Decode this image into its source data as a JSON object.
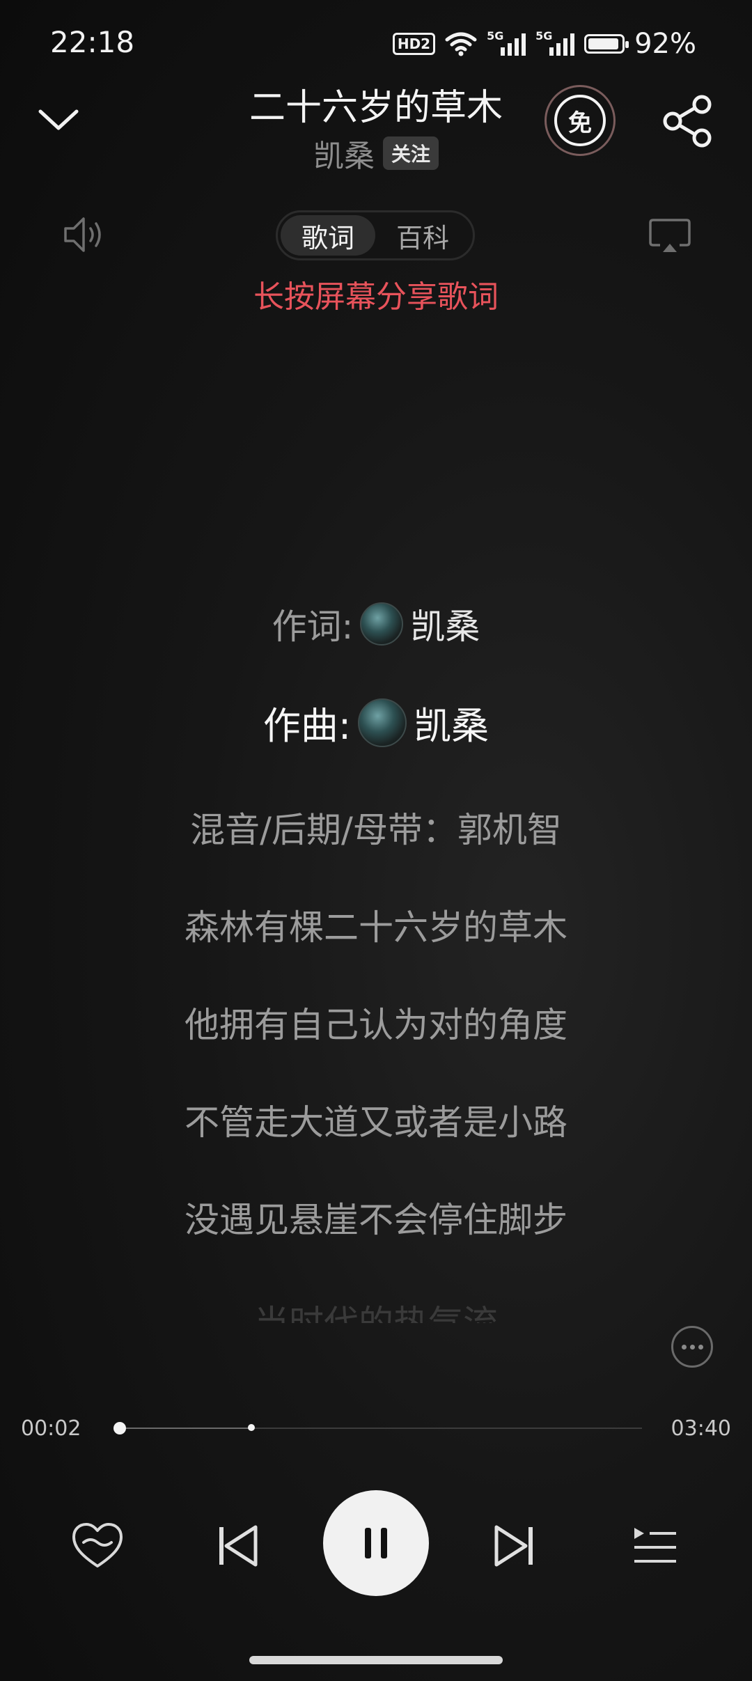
{
  "status_bar": {
    "time": "22:18",
    "hd_label": "HD2",
    "signal1_label": "5G",
    "signal2_label": "5G",
    "battery_percent": "92%",
    "battery_level": 0.92
  },
  "header": {
    "title": "二十六岁的草木",
    "artist": "凯桑",
    "follow_label": "关注",
    "free_label": "免"
  },
  "tabs": [
    {
      "label": "歌词",
      "active": true
    },
    {
      "label": "百科",
      "active": false
    }
  ],
  "hint": "长按屏幕分享歌词",
  "lyrics": {
    "credit_lyricist_label": "作词:",
    "credit_lyricist_name": "凯桑",
    "credit_composer_label": "作曲:",
    "credit_composer_name": "凯桑",
    "lines": [
      "混音/后期/母带：郭机智",
      "森林有棵二十六岁的草木",
      "他拥有自己认为对的角度",
      "不管走大道又或者是小路",
      "没遇见悬崖不会停住脚步",
      "当时代的热气流"
    ]
  },
  "player": {
    "elapsed": "00:02",
    "total": "03:40",
    "progress": 0.01,
    "buffered": 0.26
  },
  "colors": {
    "accent_hint": "#e8535b",
    "background": "#121212"
  },
  "icons": [
    "chevron-down-icon",
    "free-icon",
    "share-icon",
    "volume-icon",
    "cast-icon",
    "more-icon",
    "heart-icon",
    "previous-icon",
    "pause-icon",
    "next-icon",
    "playlist-icon"
  ]
}
